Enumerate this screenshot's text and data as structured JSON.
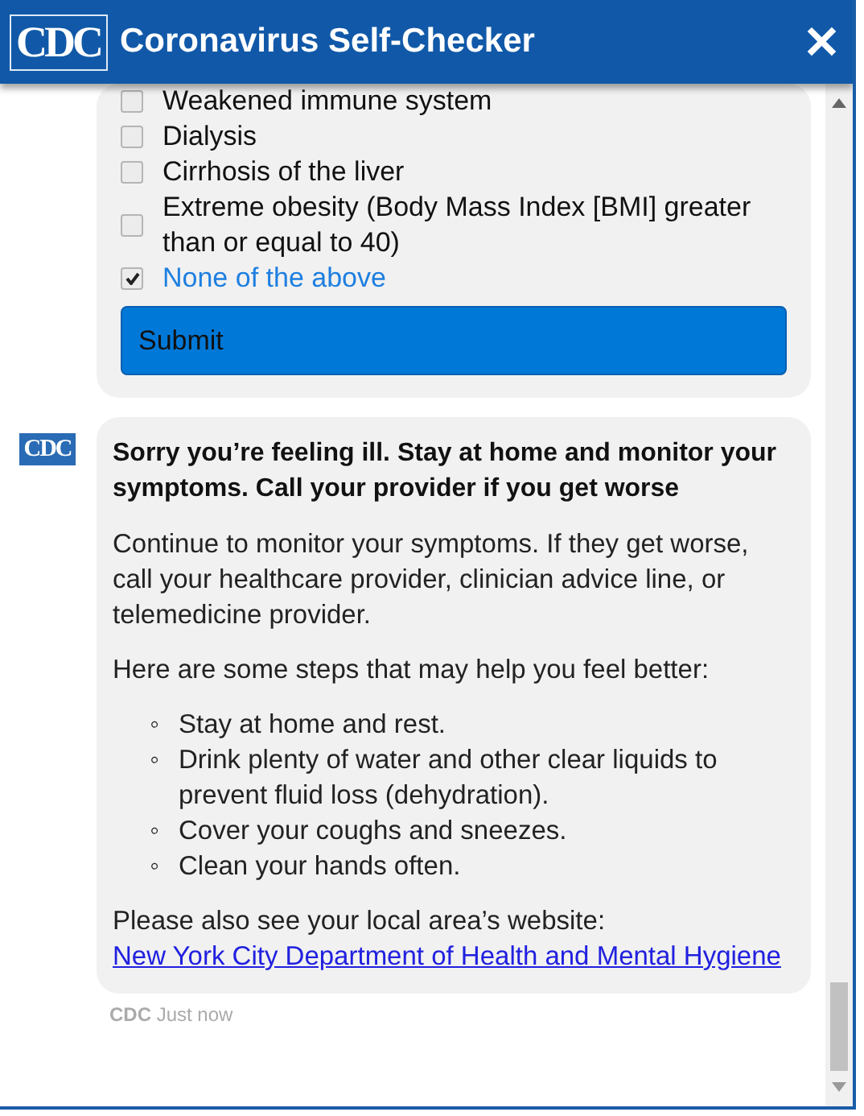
{
  "header": {
    "logo": "CDC",
    "title": "Coronavirus Self-Checker",
    "close": "✕"
  },
  "question": {
    "options": [
      {
        "label": "Weakened immune system",
        "checked": false
      },
      {
        "label": "Dialysis",
        "checked": false
      },
      {
        "label": "Cirrhosis of the liver",
        "checked": false
      },
      {
        "label": "Extreme obesity (Body Mass Index [BMI] greater than or equal to 40)",
        "checked": false
      },
      {
        "label": "None of the above",
        "checked": true
      }
    ],
    "submit": "Submit"
  },
  "reply": {
    "avatar": "CDC",
    "heading": "Sorry you’re feeling ill. Stay at home and monitor your symptoms. Call your provider if you get worse",
    "intro": "Continue to monitor your symptoms. If they get worse, call your healthcare provider, clinician advice line, or telemedicine provider.",
    "steps_intro": "Here are some steps that may help you feel better:",
    "bullet": "◦",
    "steps": [
      "Stay at home and rest.",
      "Drink plenty of water and other clear liquids to prevent fluid loss (dehydration).",
      "Cover your coughs and sneezes.",
      "Clean your hands often."
    ],
    "local": "Please also see your local area’s website:",
    "link": "New York City Department of Health and Mental Hygiene",
    "sender": "CDC",
    "time": "Just now"
  }
}
